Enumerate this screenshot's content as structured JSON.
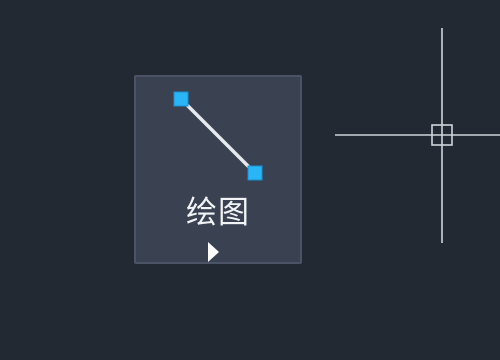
{
  "ribbon": {
    "draw_button": {
      "label": "绘图",
      "icon": "line-icon",
      "expand_icon": "triangle-right-icon"
    }
  },
  "viewport": {
    "cursor_icon": "crosshair-cursor-icon"
  },
  "colors": {
    "background": "#222933",
    "button_bg": "#3a4252",
    "button_border": "#4b5466",
    "grip": "#29b6f6",
    "line": "#e6e9ee",
    "crosshair": "#d0d4da"
  }
}
